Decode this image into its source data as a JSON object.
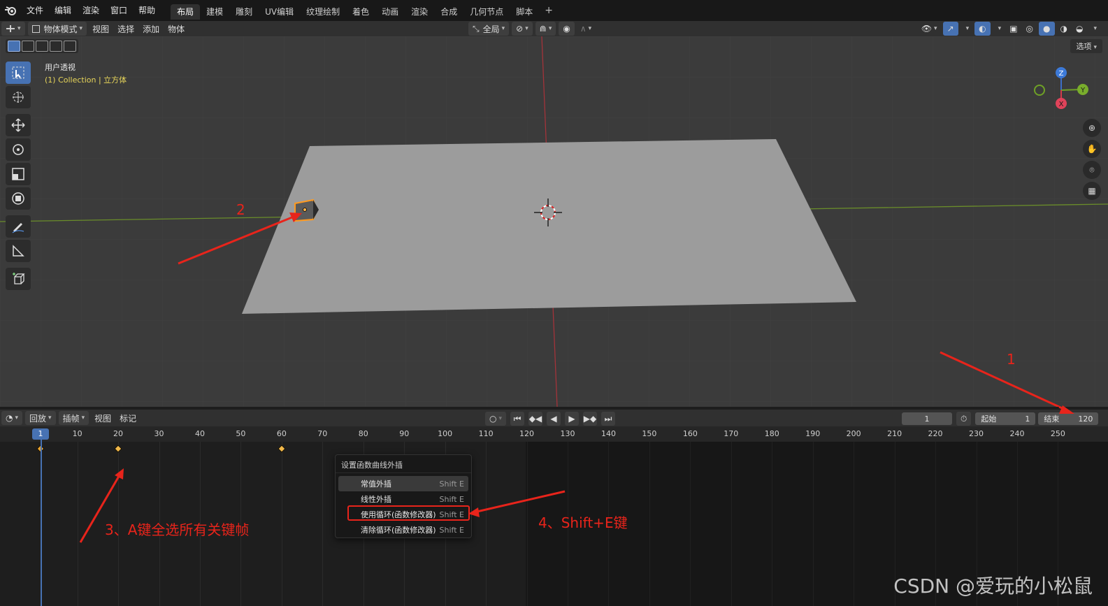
{
  "menubar": {
    "items": [
      "文件",
      "编辑",
      "渲染",
      "窗口",
      "帮助"
    ],
    "workspaces": [
      "布局",
      "建模",
      "雕刻",
      "UV编辑",
      "纹理绘制",
      "着色",
      "动画",
      "渲染",
      "合成",
      "几何节点",
      "脚本"
    ],
    "active_workspace": "布局"
  },
  "viewport_header": {
    "mode": "物体模式",
    "menus": [
      "视图",
      "选择",
      "添加",
      "物体"
    ],
    "transform_orientation": "全局"
  },
  "viewport": {
    "view_name": "用户透视",
    "collection_info": "(1) Collection | 立方体",
    "options_label": "选项",
    "gizmo": {
      "z": "Z",
      "y": "Y",
      "x": "X"
    }
  },
  "timeline_header": {
    "menus": [
      "回放",
      "插帧",
      "视图",
      "标记"
    ],
    "current_frame": "1",
    "start_label": "起始",
    "start_value": "1",
    "end_label": "结束",
    "end_value": "120"
  },
  "timeline": {
    "current": "1",
    "ticks": [
      "10",
      "20",
      "30",
      "40",
      "50",
      "60",
      "70",
      "80",
      "90",
      "100",
      "110",
      "120",
      "130",
      "140",
      "150",
      "160",
      "170",
      "180",
      "190",
      "200",
      "210",
      "220",
      "230",
      "240",
      "250"
    ],
    "keyframes": [
      1,
      20,
      60
    ]
  },
  "context_menu": {
    "title": "设置函数曲线外插",
    "items": [
      {
        "label": "常值外插",
        "shortcut": "Shift E"
      },
      {
        "label": "线性外插",
        "shortcut": "Shift E"
      },
      {
        "label": "使用循环(函数修改器)",
        "shortcut": "Shift E"
      },
      {
        "label": "清除循环(函数修改器)",
        "shortcut": "Shift E"
      }
    ]
  },
  "annotations": {
    "a1": "1",
    "a2": "2",
    "a3": "3、A键全选所有关键帧",
    "a4": "4、Shift+E键"
  },
  "watermark": "CSDN @爱玩的小松鼠",
  "colors": {
    "accent": "#4772b3",
    "annotation": "#e8241b",
    "keyframe": "#e8a431"
  }
}
